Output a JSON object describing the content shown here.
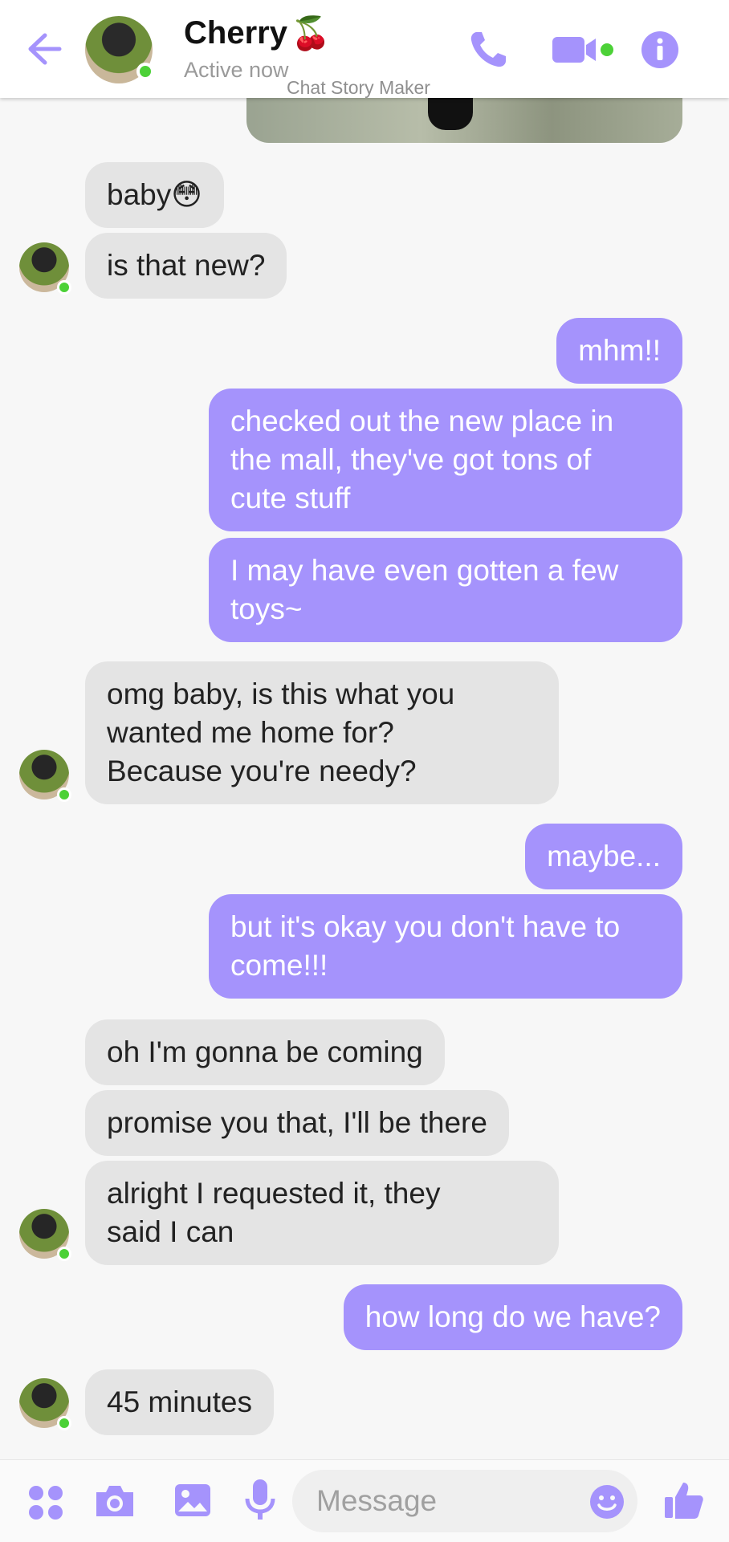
{
  "header": {
    "contact_name": "Cherry",
    "name_emoji": "🍒",
    "status": "Active now",
    "watermark": "Chat Story Maker"
  },
  "colors": {
    "accent": "#a593fc",
    "received_bubble": "#e4e4e4",
    "online": "#4cd137"
  },
  "messages": [
    {
      "from": "contact",
      "text": "baby😳"
    },
    {
      "from": "contact",
      "text": "is that new?"
    },
    {
      "from": "me",
      "text": "mhm!!"
    },
    {
      "from": "me",
      "text": "checked out the new place in\nthe mall, they've got tons of\ncute stuff"
    },
    {
      "from": "me",
      "text": "I may have even gotten a few\ntoys~"
    },
    {
      "from": "contact",
      "text": "omg baby, is this what you\nwanted me home for?\nBecause you're needy?"
    },
    {
      "from": "me",
      "text": "maybe..."
    },
    {
      "from": "me",
      "text": "but it's okay you don't have to\ncome!!!"
    },
    {
      "from": "contact",
      "text": "oh I'm gonna be coming"
    },
    {
      "from": "contact",
      "text": "promise you that, I'll be there"
    },
    {
      "from": "contact",
      "text": "alright I requested it, they\nsaid I can"
    },
    {
      "from": "me",
      "text": "how long do we have?"
    },
    {
      "from": "contact",
      "text": "45 minutes"
    }
  ],
  "composer": {
    "placeholder": "Message"
  },
  "icons": [
    "back-arrow-icon",
    "phone-icon",
    "video-camera-icon",
    "info-icon",
    "apps-grid-icon",
    "camera-icon",
    "gallery-icon",
    "microphone-icon",
    "emoji-icon",
    "thumbs-up-icon"
  ]
}
